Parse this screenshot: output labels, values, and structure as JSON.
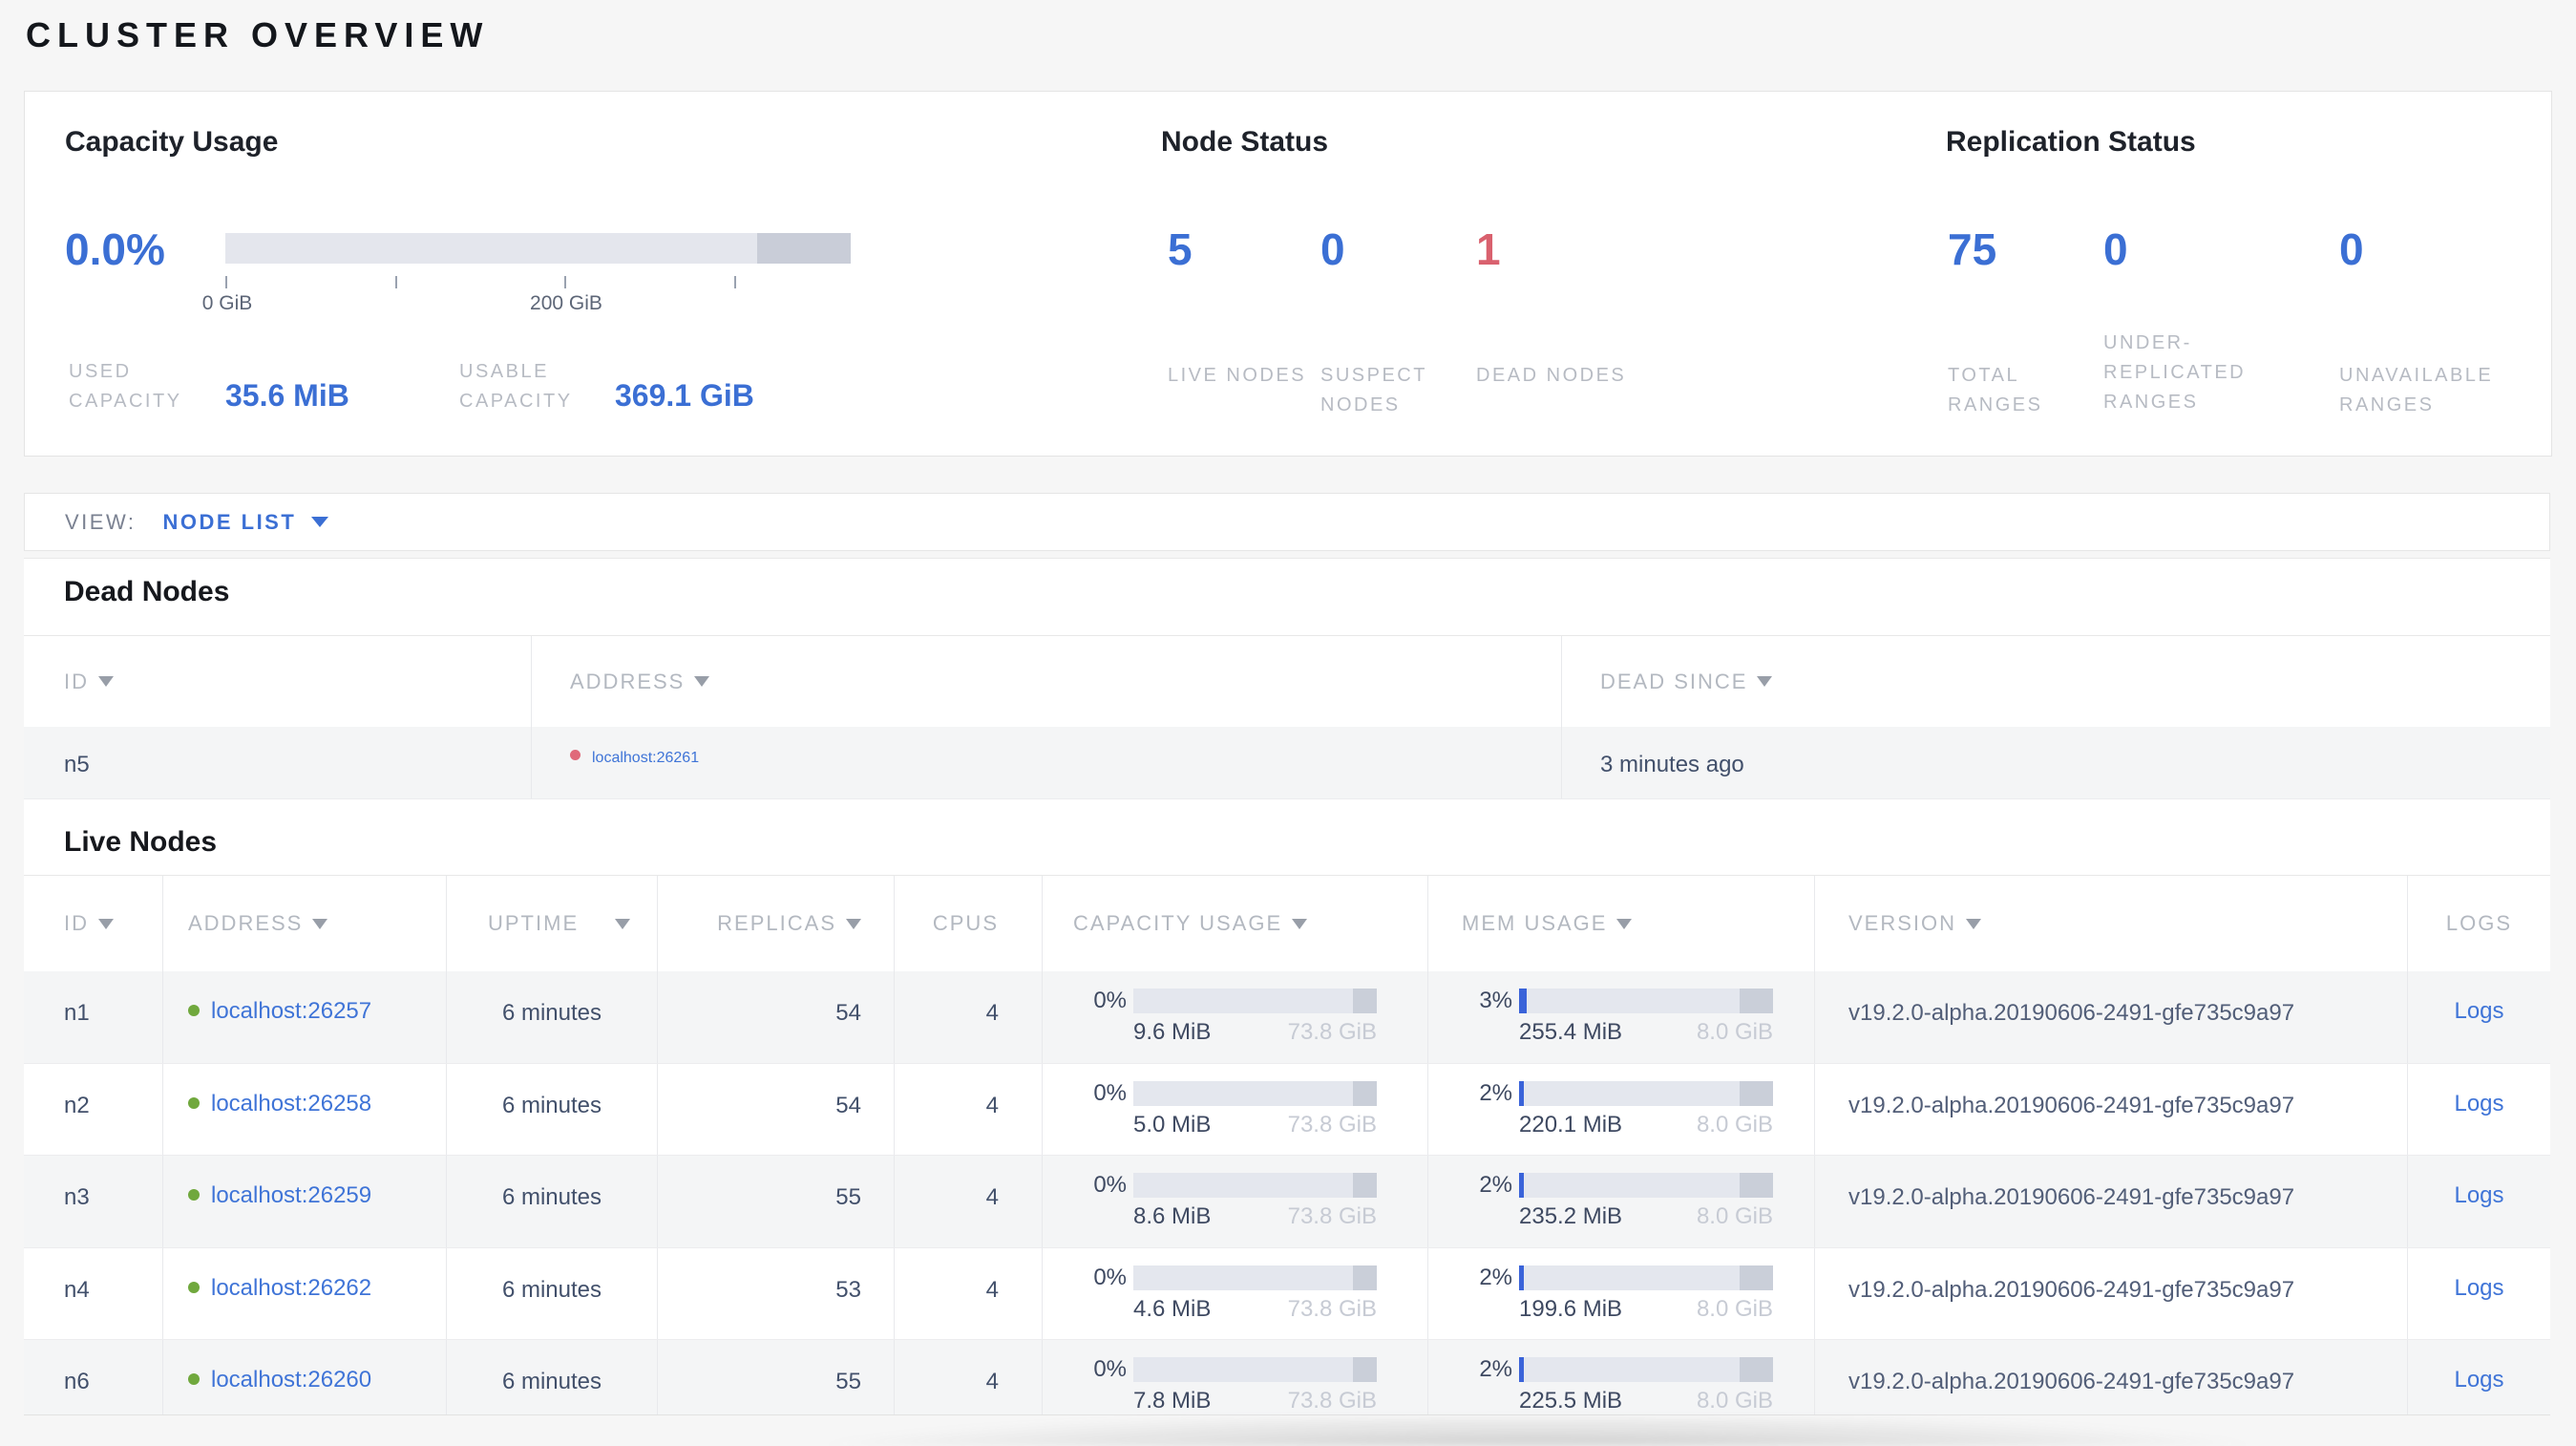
{
  "page": {
    "title": "CLUSTER OVERVIEW"
  },
  "colors": {
    "accent_blue": "#3b6fd4",
    "alert_red": "#d9616e",
    "link_blue": "#3f74d7",
    "live_dot_green": "#70a83d",
    "dead_dot_red": "#e0697a",
    "bar_light": "#e4e7ee",
    "bar_dark": "#cacfd9",
    "bar_used_blue": "#3a63d9"
  },
  "summary": {
    "capacity": {
      "title": "Capacity Usage",
      "percent": "0.0%",
      "tick_labels": [
        "0 GiB",
        "200 GiB"
      ],
      "stats": [
        {
          "label": "USED CAPACITY",
          "value": "35.6 MiB"
        },
        {
          "label": "USABLE CAPACITY",
          "value": "369.1 GiB"
        }
      ]
    },
    "node_status": {
      "title": "Node Status",
      "stats": [
        {
          "value": "5",
          "label": "LIVE NODES"
        },
        {
          "value": "0",
          "label": "SUSPECT NODES"
        },
        {
          "value": "1",
          "label": "DEAD NODES"
        }
      ]
    },
    "replication": {
      "title": "Replication Status",
      "stats": [
        {
          "value": "75",
          "label": "TOTAL RANGES"
        },
        {
          "value": "0",
          "label": "UNDER-REPLICATED RANGES"
        },
        {
          "value": "0",
          "label": "UNAVAILABLE RANGES"
        }
      ]
    }
  },
  "view_bar": {
    "label": "VIEW:",
    "selected": "NODE LIST"
  },
  "dead_nodes": {
    "heading": "Dead Nodes",
    "columns": [
      "ID",
      "ADDRESS",
      "DEAD SINCE"
    ],
    "rows": [
      {
        "id": "n5",
        "address": "localhost:26261",
        "dead_since": "3 minutes ago"
      }
    ]
  },
  "live_nodes": {
    "heading": "Live Nodes",
    "columns": [
      "ID",
      "ADDRESS",
      "UPTIME",
      "REPLICAS",
      "CPUS",
      "CAPACITY USAGE",
      "MEM USAGE",
      "VERSION",
      "LOGS"
    ],
    "rows": [
      {
        "id": "n1",
        "address": "localhost:26257",
        "uptime": "6 minutes",
        "replicas": "54",
        "cpus": "4",
        "capacity": {
          "pct": "0%",
          "pct_num": 0,
          "used": "9.6 MiB",
          "total": "73.8 GiB"
        },
        "mem": {
          "pct": "3%",
          "pct_num": 3,
          "used": "255.4 MiB",
          "total": "8.0 GiB"
        },
        "version": "v19.2.0-alpha.20190606-2491-gfe735c9a97",
        "logs": "Logs"
      },
      {
        "id": "n2",
        "address": "localhost:26258",
        "uptime": "6 minutes",
        "replicas": "54",
        "cpus": "4",
        "capacity": {
          "pct": "0%",
          "pct_num": 0,
          "used": "5.0 MiB",
          "total": "73.8 GiB"
        },
        "mem": {
          "pct": "2%",
          "pct_num": 2,
          "used": "220.1 MiB",
          "total": "8.0 GiB"
        },
        "version": "v19.2.0-alpha.20190606-2491-gfe735c9a97",
        "logs": "Logs"
      },
      {
        "id": "n3",
        "address": "localhost:26259",
        "uptime": "6 minutes",
        "replicas": "55",
        "cpus": "4",
        "capacity": {
          "pct": "0%",
          "pct_num": 0,
          "used": "8.6 MiB",
          "total": "73.8 GiB"
        },
        "mem": {
          "pct": "2%",
          "pct_num": 2,
          "used": "235.2 MiB",
          "total": "8.0 GiB"
        },
        "version": "v19.2.0-alpha.20190606-2491-gfe735c9a97",
        "logs": "Logs"
      },
      {
        "id": "n4",
        "address": "localhost:26262",
        "uptime": "6 minutes",
        "replicas": "53",
        "cpus": "4",
        "capacity": {
          "pct": "0%",
          "pct_num": 0,
          "used": "4.6 MiB",
          "total": "73.8 GiB"
        },
        "mem": {
          "pct": "2%",
          "pct_num": 2,
          "used": "199.6 MiB",
          "total": "8.0 GiB"
        },
        "version": "v19.2.0-alpha.20190606-2491-gfe735c9a97",
        "logs": "Logs"
      },
      {
        "id": "n6",
        "address": "localhost:26260",
        "uptime": "6 minutes",
        "replicas": "55",
        "cpus": "4",
        "capacity": {
          "pct": "0%",
          "pct_num": 0,
          "used": "7.8 MiB",
          "total": "73.8 GiB"
        },
        "mem": {
          "pct": "2%",
          "pct_num": 2,
          "used": "225.5 MiB",
          "total": "8.0 GiB"
        },
        "version": "v19.2.0-alpha.20190606-2491-gfe735c9a97",
        "logs": "Logs"
      }
    ]
  }
}
